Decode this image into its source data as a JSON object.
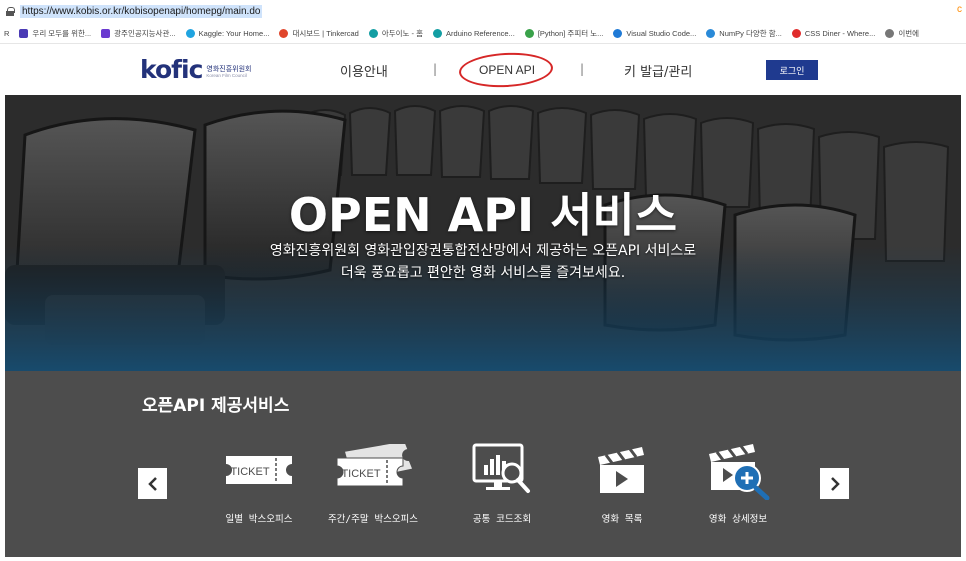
{
  "browser": {
    "url": "https://www.kobis.or.kr/kobisopenapi/homepg/main.do",
    "right_char": "c",
    "bookmarks": [
      {
        "label": "R",
        "icon": "r-letter-icon",
        "color": ""
      },
      {
        "label": "우리 모두를 위한...",
        "icon": "bookmark-favicon-icon",
        "color": "#4a3ab5"
      },
      {
        "label": "광주인공지능사관...",
        "icon": "bookmark-favicon-icon",
        "color": "#6a3ad0"
      },
      {
        "label": "Kaggle: Your Home...",
        "icon": "kaggle-icon",
        "color": "#20a4e0"
      },
      {
        "label": "대시보드 | Tinkercad",
        "icon": "tinkercad-icon",
        "color": "#e0462c"
      },
      {
        "label": "아두이노 - 홈",
        "icon": "arduino-icon",
        "color": "#139ea3"
      },
      {
        "label": "Arduino Reference...",
        "icon": "arduino-icon",
        "color": "#139ea3"
      },
      {
        "label": "[Python] 주피터 노...",
        "icon": "bookmark-favicon-icon",
        "color": "#3aa24a"
      },
      {
        "label": "Visual Studio Code...",
        "icon": "vscode-icon",
        "color": "#1f7ad6"
      },
      {
        "label": "NumPy 다양한 함...",
        "icon": "bookmark-favicon-icon",
        "color": "#2a8ad8"
      },
      {
        "label": "CSS Diner - Where...",
        "icon": "bookmark-favicon-icon",
        "color": "#e02c2c"
      },
      {
        "label": "이번에",
        "icon": "bookmark-favicon-icon",
        "color": "#777777"
      }
    ]
  },
  "header": {
    "logo_word": "kofic",
    "logo_korean": "영화진흥위원회",
    "logo_english": "Korean Film Council",
    "nav": [
      "이용안내",
      "OPEN API",
      "키 발급/관리"
    ],
    "separator": "|",
    "login": "로그인"
  },
  "hero": {
    "title": "OPEN API 서비스",
    "line1": "영화진흥위원회 영화관입장권통합전산망에서 제공하는 오픈API 서비스로",
    "line2": "더욱 풍요롭고 편안한 영화 서비스를 즐겨보세요."
  },
  "services": {
    "title": "오픈API 제공서비스",
    "ticket_text": "TICKET",
    "items": [
      {
        "label": "일별 박스오피스",
        "icon": "ticket-icon"
      },
      {
        "label": "주간/주말 박스오피스",
        "icon": "double-ticket-icon"
      },
      {
        "label": "공통 코드조회",
        "icon": "monitor-chart-search-icon"
      },
      {
        "label": "영화 목록",
        "icon": "clapperboard-play-icon"
      },
      {
        "label": "영화 상세정보",
        "icon": "clapperboard-zoom-icon"
      }
    ]
  },
  "colors": {
    "brand": "#23327a",
    "login_bg": "#1f3a8f",
    "highlight_circle": "#d62727",
    "services_bg": "#4d4d4d"
  }
}
